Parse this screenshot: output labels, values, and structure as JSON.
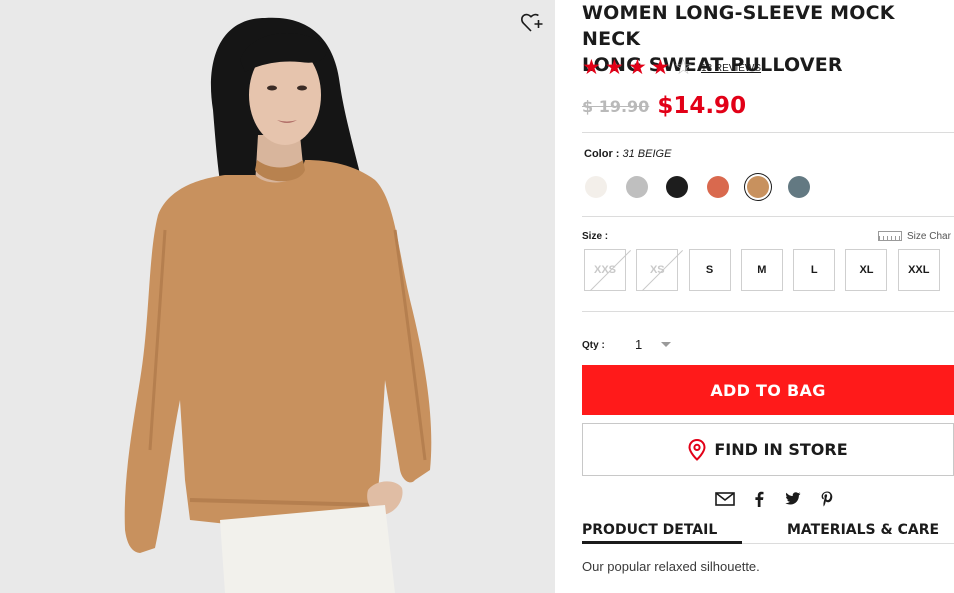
{
  "product": {
    "title": "WOMEN LONG-SLEEVE MOCK NECK\nLONG SWEAT PULLOVER",
    "rating_value": 4,
    "rating_max": 5,
    "reviews_label": "13 REVIEWS",
    "old_price": "$ 19.90",
    "new_price": "$14.90",
    "description": "Our popular relaxed silhouette."
  },
  "image": {
    "wishlist_icon": "heart-plus-icon"
  },
  "color": {
    "label": "Color :",
    "selected_name": "31 BEIGE",
    "swatches": [
      {
        "name": "off-white",
        "hex": "#f3efea"
      },
      {
        "name": "gray",
        "hex": "#bfbfbf"
      },
      {
        "name": "black",
        "hex": "#1d1d1d"
      },
      {
        "name": "orange",
        "hex": "#d9694e"
      },
      {
        "name": "beige",
        "hex": "#c8915e",
        "selected": true
      },
      {
        "name": "blue-gray",
        "hex": "#637982"
      }
    ]
  },
  "size": {
    "label": "Size :",
    "chart_label": "Size Char",
    "options": [
      {
        "label": "XXS",
        "available": false
      },
      {
        "label": "XS",
        "available": false
      },
      {
        "label": "S",
        "available": true
      },
      {
        "label": "M",
        "available": true
      },
      {
        "label": "L",
        "available": true
      },
      {
        "label": "XL",
        "available": true
      },
      {
        "label": "XXL",
        "available": true
      }
    ]
  },
  "quantity": {
    "label": "Qty :",
    "value": "1"
  },
  "actions": {
    "add_to_bag": "ADD TO BAG",
    "find_in_store": "FIND IN STORE"
  },
  "share": [
    "email-icon",
    "facebook-icon",
    "twitter-icon",
    "pinterest-icon"
  ],
  "tabs": {
    "product_detail": "PRODUCT DETAIL",
    "materials_care": "MATERIALS & CARE"
  },
  "colors": {
    "accent_red": "#e20017",
    "button_red": "#ff1a1a"
  }
}
